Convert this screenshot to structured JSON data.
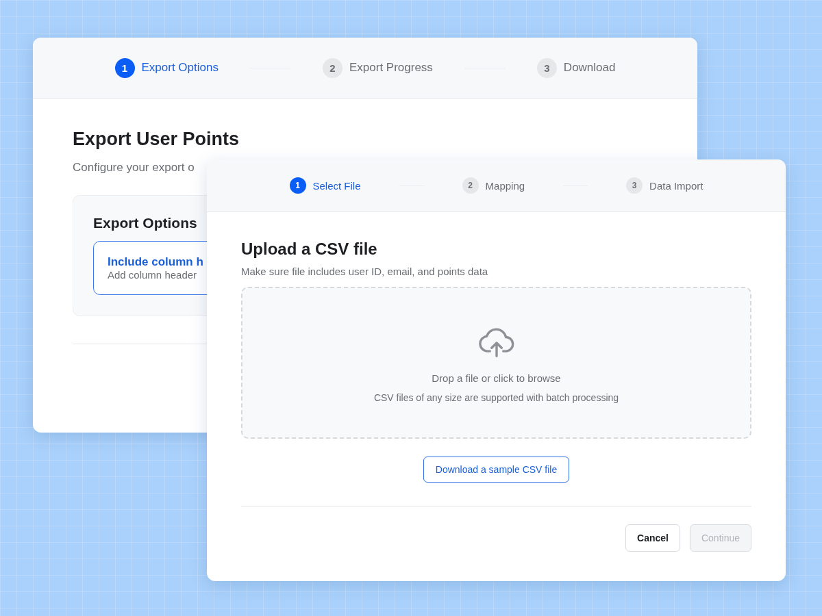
{
  "export_window": {
    "steps": [
      {
        "number": "1",
        "label": "Export Options",
        "selected": true
      },
      {
        "number": "2",
        "label": "Export Progress",
        "selected": false
      },
      {
        "number": "3",
        "label": "Download",
        "selected": false
      }
    ],
    "title": "Export User Points",
    "subtitle": "Configure your export o",
    "options_card": {
      "title": "Export Options",
      "options": [
        {
          "title": "Include column h",
          "description": "Add column header",
          "selected": true
        }
      ]
    }
  },
  "import_window": {
    "steps": [
      {
        "number": "1",
        "label": "Select File",
        "selected": true
      },
      {
        "number": "2",
        "label": "Mapping",
        "selected": false
      },
      {
        "number": "3",
        "label": "Data Import",
        "selected": false
      }
    ],
    "title": "Upload a CSV file",
    "subtitle": "Make sure file includes user ID, email, and points data",
    "dropzone": {
      "prompt": "Drop a file or click to browse",
      "hint": "CSV files of any size are supported with batch processing"
    },
    "sample_link": "Download a sample CSV file",
    "buttons": [
      {
        "label": "Cancel",
        "disabled": false
      },
      {
        "label": "Continue",
        "disabled": true
      }
    ]
  }
}
